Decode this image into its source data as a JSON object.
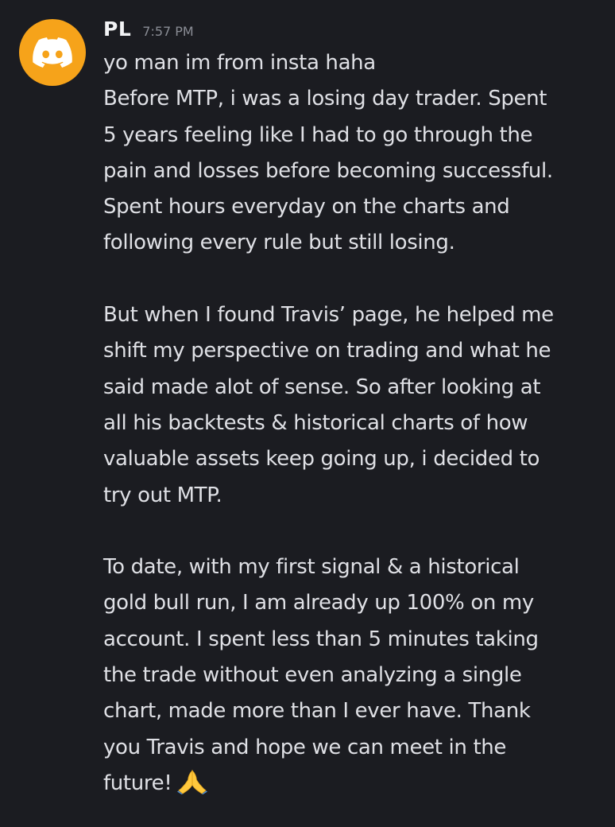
{
  "message": {
    "author": "PL",
    "timestamp": "7:57 PM",
    "avatar_color": "#f6a31a",
    "avatar_icon": "discord-logo-icon",
    "paragraphs": [
      {
        "lines": [
          "yo man im from insta haha",
          "Before MTP, i was a losing day trader. Spent",
          "5 years feeling like I had to go through the",
          "pain and losses before becoming successful.",
          "Spent hours everyday on the charts and",
          "following every rule but still losing."
        ]
      },
      {
        "lines": [
          "But when I found Travis’ page, he helped me",
          "shift my perspective on trading and what he",
          "said made alot of sense. So after looking at",
          "all his backtests & historical charts of how",
          "valuable assets keep going up, i decided to",
          "try out MTP."
        ]
      },
      {
        "lines": [
          "To date, with my first signal & a historical",
          "gold bull run, I am already up 100% on my",
          "account. I spent less than 5 minutes taking",
          "the trade without even analyzing a single",
          "chart, made more than I ever have. Thank",
          "you Travis and hope we can meet in the",
          "future!"
        ]
      }
    ],
    "trailing_emoji": "folded-hands-emoji"
  }
}
